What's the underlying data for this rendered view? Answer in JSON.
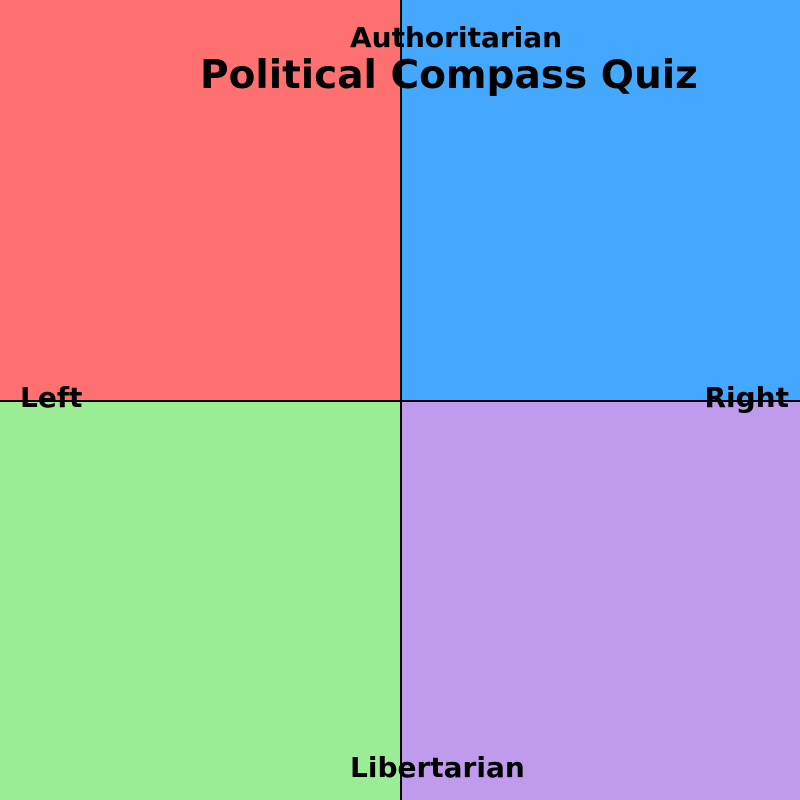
{
  "title": "Political Compass Quiz",
  "axes": {
    "top": "Authoritarian",
    "bottom": "Libertarian",
    "left": "Left",
    "right": "Right"
  },
  "colors": {
    "authoritarian_left": "#ff7171",
    "authoritarian_right": "#44a8ff",
    "libertarian_left": "#9aed94",
    "libertarian_right": "#c09aed",
    "axis_line": "#000000",
    "text": "#000000"
  }
}
